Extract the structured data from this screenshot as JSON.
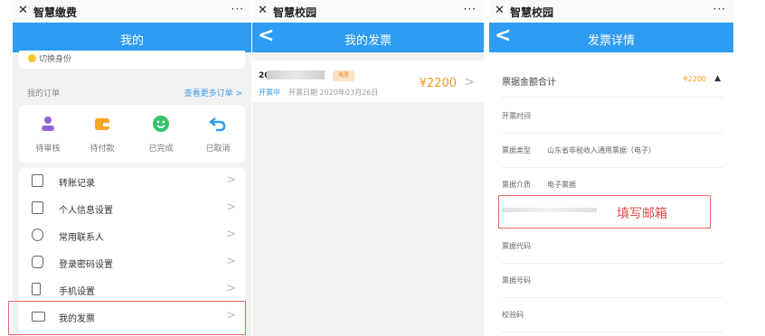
{
  "panels": {
    "mine": {
      "window_title": "智慧缴费",
      "header_title": "我的",
      "switch_identity": "切换身份",
      "orders_title": "我的订单",
      "orders_more": "查看更多订单 >",
      "order_statuses": [
        {
          "label": "待审核",
          "icon": "person-icon",
          "color": "#8e63d6"
        },
        {
          "label": "待付款",
          "icon": "wallet-icon",
          "color": "#f6a623"
        },
        {
          "label": "已完成",
          "icon": "smile-icon",
          "color": "#35c46b"
        },
        {
          "label": "已取消",
          "icon": "undo-icon",
          "color": "#2d9cf2"
        }
      ],
      "menu": [
        {
          "label": "转账记录",
          "icon": "list-icon"
        },
        {
          "label": "个人信息设置",
          "icon": "settings-icon"
        },
        {
          "label": "常用联系人",
          "icon": "contacts-icon"
        },
        {
          "label": "登录密码设置",
          "icon": "lock-icon"
        },
        {
          "label": "手机设置",
          "icon": "phone-icon"
        },
        {
          "label": "我的发票",
          "icon": "invoice-icon"
        }
      ]
    },
    "invoices": {
      "window_title": "智慧校园",
      "header_title": "我的发票",
      "item": {
        "number_prefix": "20",
        "badge": "电票",
        "status": "开票中",
        "date_text": "开票日期  2020年03月26日",
        "amount": "¥2200"
      }
    },
    "detail": {
      "window_title": "智慧校园",
      "header_title": "发票详情",
      "total_label": "票据金额合计",
      "total_amount": "¥2200",
      "rows": [
        {
          "label": "开票时间",
          "value": ""
        },
        {
          "label": "票据类型",
          "value": "山东省非税收入通用票据（电子）"
        },
        {
          "label": "票据介质",
          "value": "电子票据"
        }
      ],
      "email_hint": "填写邮箱",
      "rows_after": [
        {
          "label": "票据代码"
        },
        {
          "label": "票据号码"
        },
        {
          "label": "校验码"
        }
      ]
    }
  },
  "colors": {
    "primary": "#2d9cf2",
    "amount": "#f39a1b",
    "highlight": "#e66666"
  }
}
